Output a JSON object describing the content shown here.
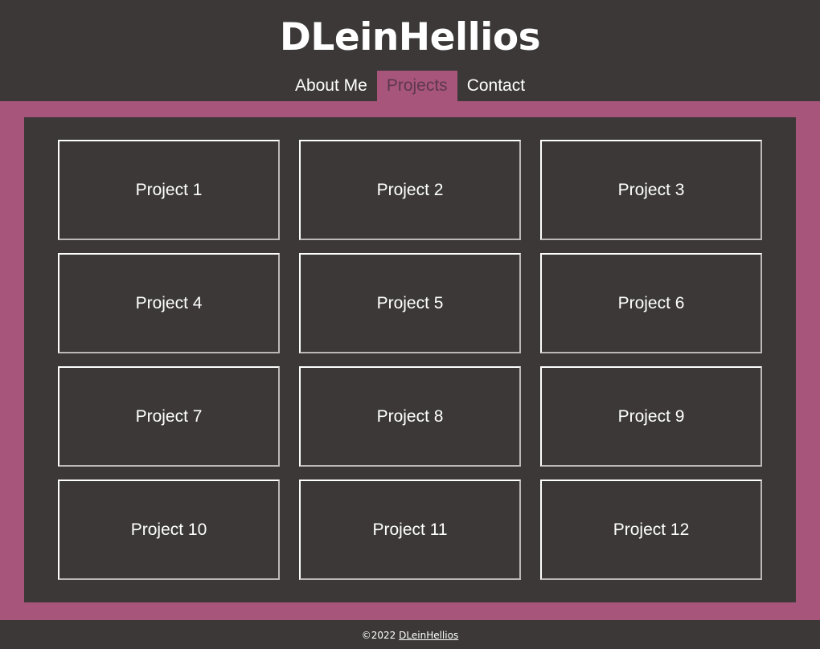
{
  "header": {
    "title": "DLeinHellios"
  },
  "nav": {
    "items": [
      {
        "label": "About Me"
      },
      {
        "label": "Projects"
      },
      {
        "label": "Contact"
      }
    ]
  },
  "projects": [
    {
      "label": "Project 1"
    },
    {
      "label": "Project 2"
    },
    {
      "label": "Project 3"
    },
    {
      "label": "Project 4"
    },
    {
      "label": "Project 5"
    },
    {
      "label": "Project 6"
    },
    {
      "label": "Project 7"
    },
    {
      "label": "Project 8"
    },
    {
      "label": "Project 9"
    },
    {
      "label": "Project 10"
    },
    {
      "label": "Project 11"
    },
    {
      "label": "Project 12"
    }
  ],
  "footer": {
    "copyright": "©2022",
    "link": "DLeinHellios"
  },
  "colors": {
    "background": "#3c3838",
    "accent": "#a8557b",
    "text": "#ffffff",
    "active_nav_text": "#5e3850"
  }
}
